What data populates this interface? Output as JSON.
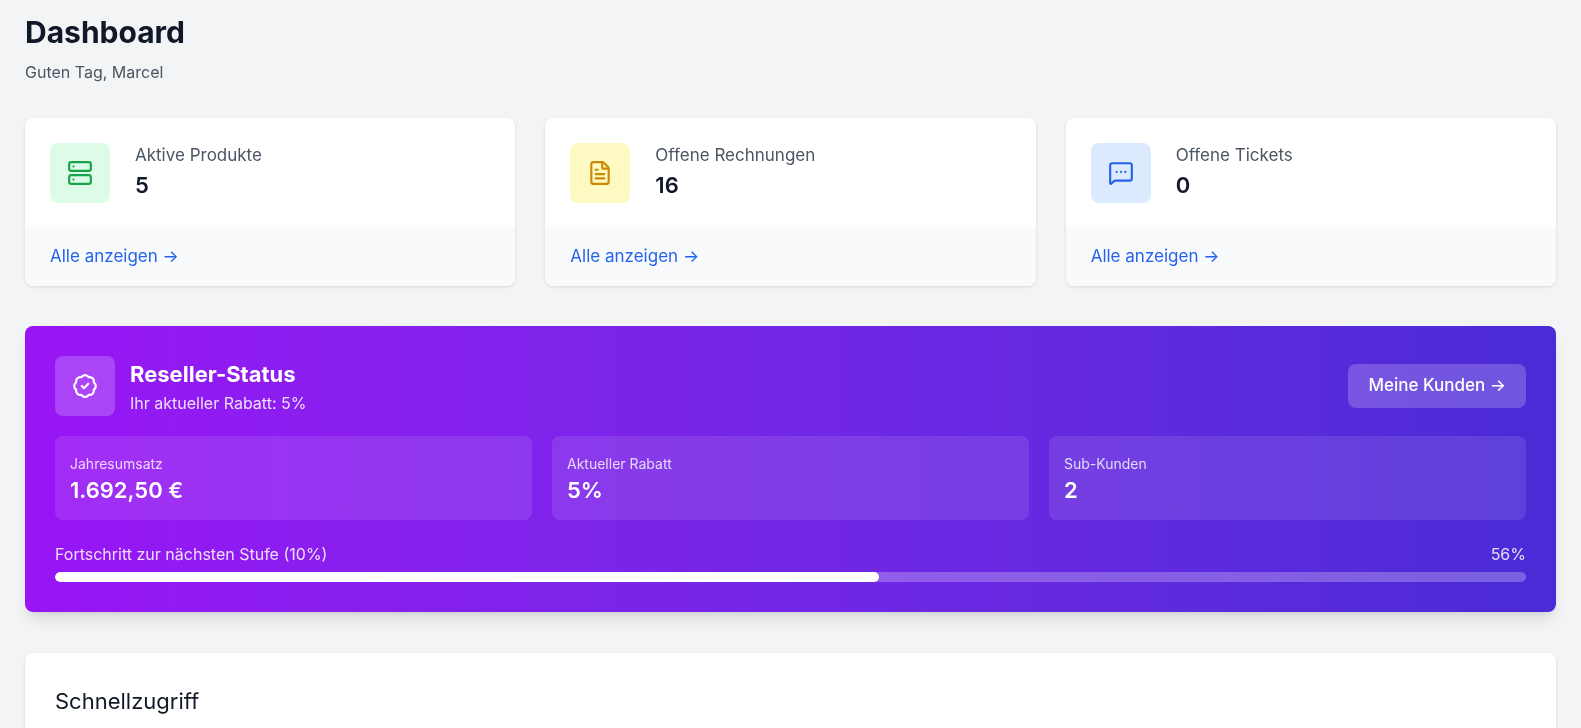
{
  "page": {
    "title": "Dashboard",
    "greeting": "Guten Tag, Marcel"
  },
  "stats": [
    {
      "kind": "products",
      "label": "Aktive Produkte",
      "value": "5",
      "link": "Alle anzeigen →"
    },
    {
      "kind": "invoices",
      "label": "Offene Rechnungen",
      "value": "16",
      "link": "Alle anzeigen →"
    },
    {
      "kind": "tickets",
      "label": "Offene Tickets",
      "value": "0",
      "link": "Alle anzeigen →"
    }
  ],
  "reseller": {
    "title": "Reseller-Status",
    "subtitle": "Ihr aktueller Rabatt: 5%",
    "button": "Meine Kunden →",
    "metrics": [
      {
        "label": "Jahresumsatz",
        "value": "1.692,50 €"
      },
      {
        "label": "Aktueller Rabatt",
        "value": "5%"
      },
      {
        "label": "Sub-Kunden",
        "value": "2"
      }
    ],
    "progress": {
      "label": "Fortschritt zur nächsten Stufe (10%)",
      "reading": "56%",
      "level": 0.56
    }
  },
  "quick_access": {
    "title": "Schnellzugriff"
  }
}
